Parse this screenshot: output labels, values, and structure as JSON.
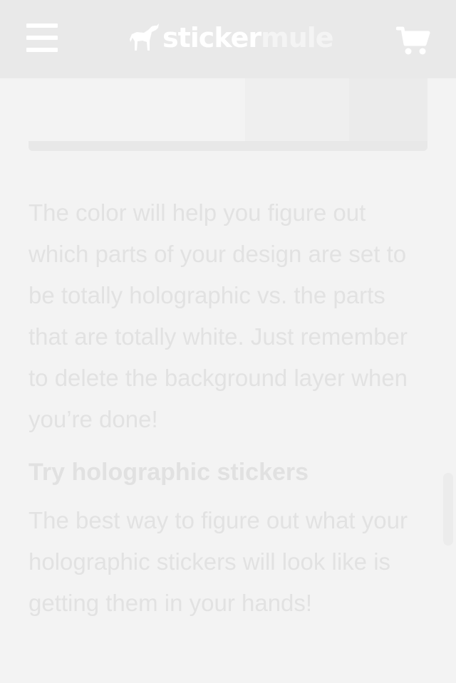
{
  "header": {
    "menu_icon": "hamburger-menu-icon",
    "logo": {
      "word1": "sticker",
      "word2": "mule",
      "icon": "mule-logo-icon"
    },
    "cart_icon": "shopping-cart-icon",
    "background": "#e9e9e9"
  },
  "article": {
    "paragraph1": "The color will help you figure out which parts of your design are set to be totally holographic vs. the parts that are totally white. Just remember to delete the background layer when you’re done!",
    "heading": "Try holographic stickers",
    "paragraph2": "The best way to figure out what your holographic stickers will look like is getting them in your hands!"
  },
  "colors": {
    "page_background": "#f3f3f3",
    "text": "#e2e2e2",
    "logo_primary": "#ffffff"
  }
}
